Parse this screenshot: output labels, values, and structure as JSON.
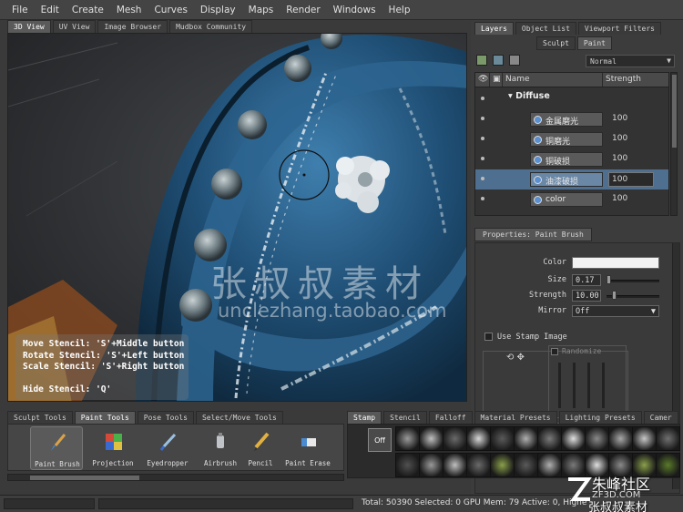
{
  "menu": [
    "File",
    "Edit",
    "Create",
    "Mesh",
    "Curves",
    "Display",
    "Maps",
    "Render",
    "Windows",
    "Help"
  ],
  "viewport_tabs": [
    "3D View",
    "UV View",
    "Image Browser",
    "Mudbox Community"
  ],
  "stencil_help": {
    "line1": "Move Stencil: 'S'+Middle button",
    "line2": "Rotate Stencil: 'S'+Left button",
    "line3": "Scale Stencil: 'S'+Right button",
    "line4": "Hide Stencil: 'Q'"
  },
  "watermark": {
    "cn": "张叔叔素材",
    "url": "unclezhang.taobao.com"
  },
  "right_tabs": [
    "Layers",
    "Object List",
    "Viewport Filters"
  ],
  "sculpt_paint": [
    "Sculpt",
    "Paint"
  ],
  "blend_mode": "Normal",
  "layers": {
    "col_name": "Name",
    "col_strength": "Strength",
    "group": "Diffuse",
    "rows": [
      {
        "name": "金属磨光",
        "strength": "100"
      },
      {
        "name": "铜磨光",
        "strength": "100"
      },
      {
        "name": "铜破损",
        "strength": "100"
      },
      {
        "name": "油漆破损",
        "strength": "100"
      },
      {
        "name": "color",
        "strength": "100"
      }
    ]
  },
  "properties": {
    "tab": "Properties: Paint Brush",
    "color_label": "Color",
    "size_label": "Size",
    "size_value": "0.17",
    "strength_label": "Strength",
    "strength_value": "10.00",
    "mirror_label": "Mirror",
    "mirror_value": "Off",
    "use_stamp_image": "Use Stamp Image",
    "randomize": "Randomize",
    "color_value": "#f2f2f2"
  },
  "tool_tabs": [
    "Sculpt Tools",
    "Paint Tools",
    "Pose Tools",
    "Select/Move Tools"
  ],
  "tools": [
    "Paint Brush",
    "Projection",
    "Eyedropper",
    "Airbrush",
    "Pencil",
    "Paint Erase"
  ],
  "stamp_tabs": [
    "Stamp",
    "Stencil",
    "Falloff",
    "Material Presets",
    "Lighting Presets",
    "Camer"
  ],
  "stamp_off": "Off",
  "status": "Total: 50390  Selected: 0  GPU Mem: 79  Active: 0, Highe",
  "site_wm": {
    "a": "朱峰社区",
    "b": "ZF3D.COM",
    "c": "张叔叔素材"
  }
}
